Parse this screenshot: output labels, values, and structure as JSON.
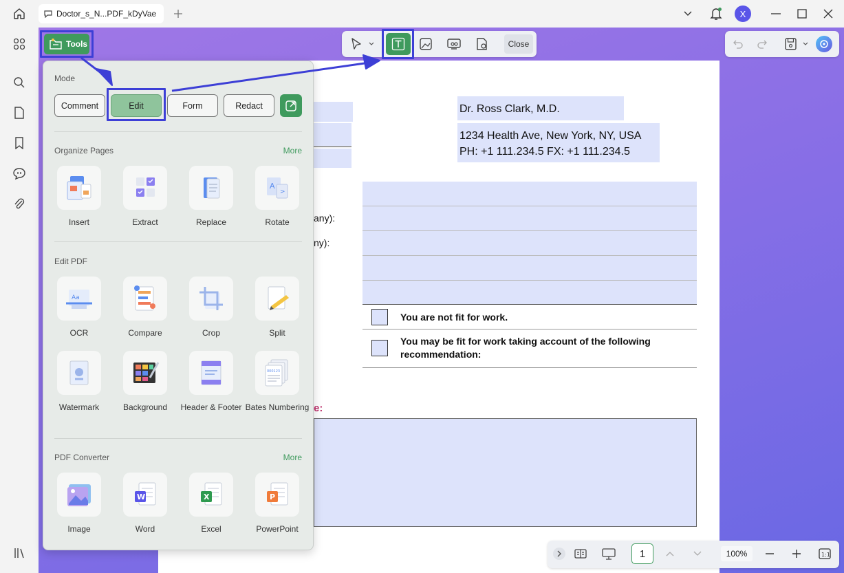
{
  "tab": {
    "title": "Doctor_s_N...PDF_kDyVae"
  },
  "user": {
    "initial": "X"
  },
  "toolbar": {
    "tools_label": "Tools",
    "close_label": "Close"
  },
  "panel": {
    "mode_title": "Mode",
    "modes": [
      "Comment",
      "Edit",
      "Form",
      "Redact"
    ],
    "organize": {
      "title": "Organize Pages",
      "more": "More",
      "items": [
        "Insert",
        "Extract",
        "Replace",
        "Rotate"
      ]
    },
    "edit_pdf": {
      "title": "Edit PDF",
      "items": [
        "OCR",
        "Compare",
        "Crop",
        "Split",
        "Watermark",
        "Background",
        "Header & Footer",
        "Bates Numbering"
      ]
    },
    "converter": {
      "title": "PDF Converter",
      "more": "More",
      "items": [
        "Image",
        "Word",
        "Excel",
        "PowerPoint"
      ]
    }
  },
  "document": {
    "doctor_name": "Dr. Ross Clark, M.D.",
    "address": "1234 Health Ave, New York, NY, USA",
    "phone": "PH: +1 111.234.5 FX: +1 111.234.5",
    "partial_label_1": "any):",
    "partial_label_2": "ny):",
    "not_fit": "You are not fit for work.",
    "may_fit_1": "You may be fit for work taking account of the following",
    "may_fit_2": "recommendation:",
    "partial_red": "e:"
  },
  "bottom": {
    "page": "1",
    "zoom": "100%"
  },
  "colors": {
    "accent_green": "#3f9a5d",
    "highlight_blue": "#3d3fd6",
    "field_fill": "#dde3fb"
  }
}
